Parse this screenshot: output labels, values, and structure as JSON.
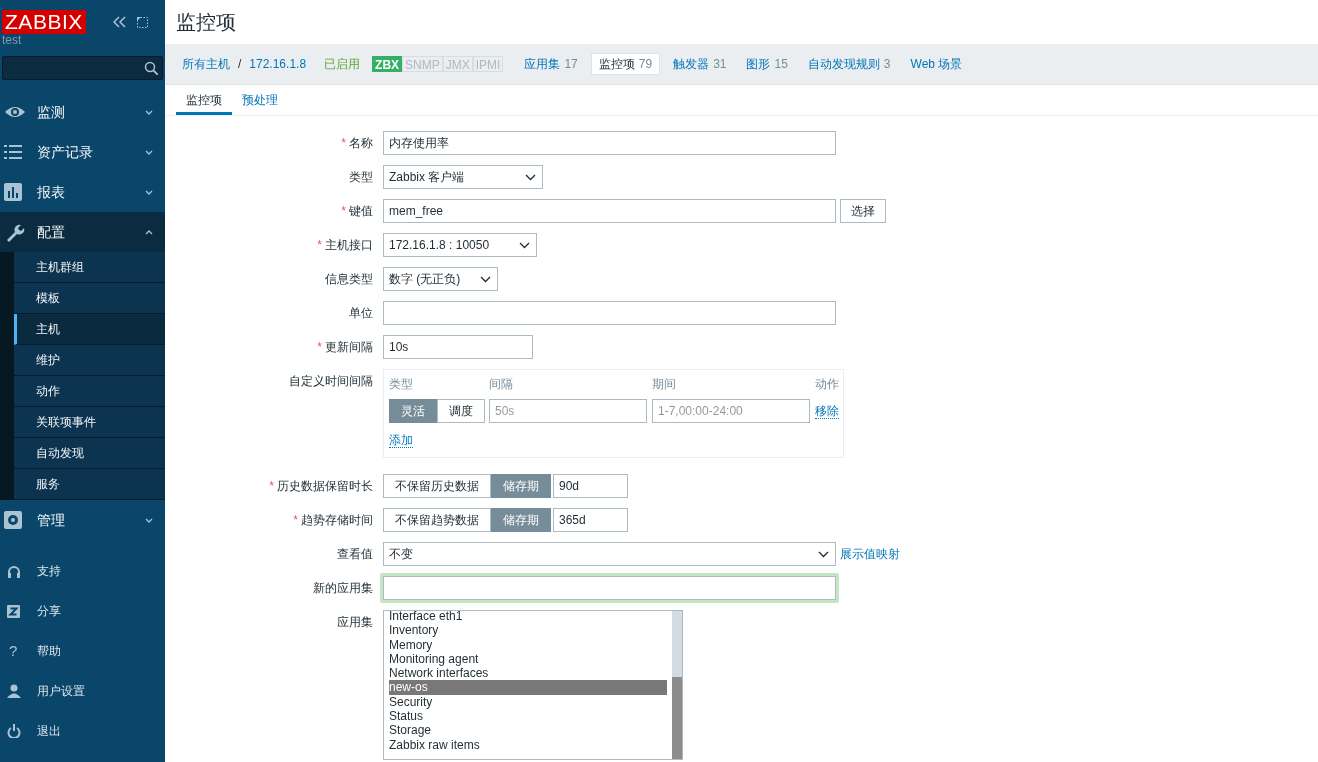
{
  "sidebar": {
    "logo": "ZABBIX",
    "user": "test",
    "menu": [
      {
        "label": "监测",
        "expanded": false
      },
      {
        "label": "资产记录",
        "expanded": false
      },
      {
        "label": "报表",
        "expanded": false
      },
      {
        "label": "配置",
        "expanded": true,
        "children": [
          {
            "label": "主机群组",
            "selected": false
          },
          {
            "label": "模板",
            "selected": false
          },
          {
            "label": "主机",
            "selected": true
          },
          {
            "label": "维护",
            "selected": false
          },
          {
            "label": "动作",
            "selected": false
          },
          {
            "label": "关联项事件",
            "selected": false
          },
          {
            "label": "自动发现",
            "selected": false
          },
          {
            "label": "服务",
            "selected": false
          }
        ]
      },
      {
        "label": "管理",
        "expanded": false
      }
    ],
    "footer": [
      {
        "label": "支持"
      },
      {
        "label": "分享"
      },
      {
        "icon_text": "?",
        "label": "帮助"
      },
      {
        "label": "用户设置"
      },
      {
        "label": "退出"
      }
    ]
  },
  "page_title": "监控项",
  "breadcrumb": {
    "root": "所有主机",
    "separator": "/",
    "host": "172.16.1.8",
    "status": "已启用",
    "availability": [
      {
        "label": "ZBX",
        "on": true
      },
      {
        "label": "SNMP",
        "on": false
      },
      {
        "label": "JMX",
        "on": false
      },
      {
        "label": "IPMI",
        "on": false
      }
    ],
    "tabs": [
      {
        "label": "应用集",
        "count": "17",
        "selected": false
      },
      {
        "label": "监控项",
        "count": "79",
        "selected": true
      },
      {
        "label": "触发器",
        "count": "31",
        "selected": false
      },
      {
        "label": "图形",
        "count": "15",
        "selected": false
      },
      {
        "label": "自动发现规则",
        "count": "3",
        "selected": false
      },
      {
        "label": "Web 场景",
        "selected": false
      }
    ]
  },
  "subtabs": [
    {
      "label": "监控项",
      "selected": true
    },
    {
      "label": "预处理",
      "selected": false
    }
  ],
  "form": [
    {
      "kind": "text",
      "label": "名称",
      "required_mark": "*",
      "value": "内存使用率"
    },
    {
      "kind": "select",
      "label": "类型",
      "value": "Zabbix 客户端"
    },
    {
      "kind": "text",
      "label": "键值",
      "required_mark": "*",
      "value": "mem_free",
      "button": "选择"
    },
    {
      "kind": "select",
      "label": "主机接口",
      "required_mark": "*",
      "value": "172.16.1.8 : 10050"
    },
    {
      "kind": "select",
      "label": "信息类型",
      "value": "数字 (无正负)"
    },
    {
      "kind": "text",
      "label": "单位"
    },
    {
      "kind": "short",
      "label": "更新间隔",
      "required_mark": "*",
      "value": "10s"
    },
    {
      "kind": "intervals",
      "label": "自定义时间间隔",
      "headers": [
        "类型",
        "间隔",
        "期间",
        "动作"
      ],
      "rows": [
        {
          "modes": [
            {
              "label": "灵活",
              "selected": true
            },
            {
              "label": "调度",
              "selected": false
            }
          ],
          "interval_placeholder": "50s",
          "period_placeholder": "1-7,00:00-24:00",
          "action": "移除"
        }
      ],
      "add": "添加"
    },
    {
      "kind": "storage",
      "label": "历史数据保留时长",
      "required_mark": "*",
      "options": [
        {
          "label": "不保留历史数据",
          "selected": false
        },
        {
          "label": "储存期",
          "selected": true
        }
      ],
      "value": "90d"
    },
    {
      "kind": "storage",
      "label": "趋势存储时间",
      "required_mark": "*",
      "options": [
        {
          "label": "不保留趋势数据",
          "selected": false
        },
        {
          "label": "储存期",
          "selected": true
        }
      ],
      "value": "365d"
    },
    {
      "kind": "wide_select",
      "label": "查看值",
      "value": "不变",
      "link": "展示值映射"
    },
    {
      "kind": "focused_text",
      "label": "新的应用集"
    },
    {
      "kind": "listbox",
      "label": "应用集",
      "items": [
        {
          "label": "Interface eth1",
          "selected": false
        },
        {
          "label": "Inventory",
          "selected": false
        },
        {
          "label": "Memory",
          "selected": false
        },
        {
          "label": "Monitoring agent",
          "selected": false
        },
        {
          "label": "Network interfaces",
          "selected": false
        },
        {
          "label": "new-os",
          "selected": true
        },
        {
          "label": "Security",
          "selected": false
        },
        {
          "label": "Status",
          "selected": false
        },
        {
          "label": "Storage",
          "selected": false
        },
        {
          "label": "Zabbix raw items",
          "selected": false
        }
      ]
    }
  ]
}
